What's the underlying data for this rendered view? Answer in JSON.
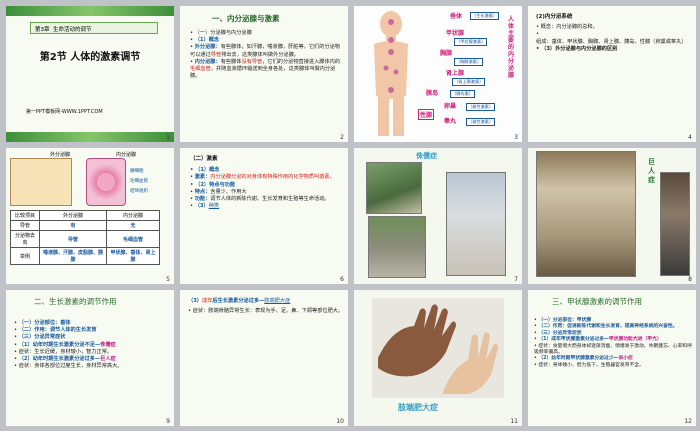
{
  "slides": [
    {
      "num": "1",
      "ch": "第3章",
      "ch_title": "生命活动的调节",
      "sec": "第2节",
      "sec_title": "人体的激素调节",
      "site": "第一PPT模板网-WWW.1PPT.COM"
    },
    {
      "num": "2",
      "title": "一、内分泌腺与激素",
      "l1": "（一）分泌腺与内分泌腺",
      "l2": "（1）概念",
      "l3a": "外分泌腺：",
      "l3b": "有些腺体，如汗腺，唾液腺，肝脏等，它们的分泌物可以通过",
      "l3c": "导管",
      "l3d": "排出去，这类腺体叫做外分泌腺。",
      "l4a": "内分泌腺：",
      "l4b": "有些腺体",
      "l4c": "没有导管",
      "l4d": "，它们的分泌物直接进入腺体内的",
      "l4e": "毛细血管",
      "l4f": "，并随血液循环输送到全身各处，这类腺体叫做内分泌腺。"
    },
    {
      "num": "3",
      "labels": [
        "垂体",
        "甲状腺",
        "胸腺",
        "肾上腺",
        "胰岛",
        "卵巢",
        "睾丸"
      ],
      "subs": [
        "（生长激素）",
        "（甲状腺激素）",
        "（胸腺激素）",
        "（肾上腺激素）",
        "（胰岛素）",
        "（雌性激素）",
        "（雄性激素）"
      ],
      "side": "人体主要的内分泌腺",
      "sex": "性腺"
    },
    {
      "num": "4",
      "title": "(2)内分泌系统",
      "l1": "概念：内分泌腺的总和。",
      "l2": "组成：垂体、甲状腺、胸腺、肾上腺、胰岛、性腺（卵巢或睾丸）",
      "l3": "（3）外分泌腺与内分泌腺的区别"
    },
    {
      "num": "5",
      "head_l": "外分泌腺",
      "head_r": "内分泌腺",
      "tags": [
        "腺细胞",
        "毛细血管",
        "结缔组织"
      ],
      "rows": [
        [
          "比较项目",
          "外分泌腺",
          "内分泌腺"
        ],
        [
          "导管",
          "有",
          "无"
        ],
        [
          "分泌物去向",
          "导管",
          "毛细血管"
        ],
        [
          "举例",
          "唾液腺、汗腺、皮脂腺、胰腺",
          "甲状腺、垂体、肾上腺"
        ]
      ]
    },
    {
      "num": "6",
      "title": "（二）激素",
      "l1": "（1）概念",
      "l2a": "激素：",
      "l2b": "内分泌腺分泌的对身体有特殊作用的化学物质叫激素。",
      "l3": "（2）特点与功能",
      "l4a": "特点：",
      "l4b": "含量少、作用大",
      "l5a": "功能：",
      "l5b": "调节人体的新陈代谢、生长发育和生殖等生命活动。",
      "l6a": "（3）",
      "l6b": "种类"
    },
    {
      "num": "7",
      "title": "侏儒症"
    },
    {
      "num": "8",
      "title": "巨人症"
    },
    {
      "num": "9",
      "title": "二、生长激素的调节作用",
      "l1": "（一）分泌部位：垂体",
      "l2": "（二）作用：调节人体的生长发育",
      "l3": "（三）分泌异常症状",
      "l4a": "（1）幼年时期生长激素分泌不足—",
      "l4b": "侏儒症",
      "l5": "症状：生长迟缓，身材矮小，智力正常。",
      "l6a": "（2）幼年时期生长激素分泌过多—",
      "l6b": "巨人症",
      "l7": "症状：身体各部位过度生长，身材异常高大。"
    },
    {
      "num": "10",
      "l1a": "（3）",
      "l1b": "成年",
      "l1c": "后生长激素分泌过多—",
      "l1d": "肢端肥大症",
      "l2": "症状：肢端骨骼异常生长：表现为手、足、鼻、下颌等部位肥大。"
    },
    {
      "num": "11",
      "caption": "肢端肥大症"
    },
    {
      "num": "12",
      "title": "三、甲状腺激素的调节作用",
      "l1": "（一）分泌部位：甲状腺",
      "l2": "（二）作用：促进新陈代谢和生长发育，提高神经系统的兴奋性。",
      "l3": "（三）分泌异常症状",
      "l4a": "（1）成年甲状腺激素分泌过多—",
      "l4b": "甲状腺功能亢进（甲亢）",
      "l5": "症状：食量增大而身体却逐渐消瘦、情绪易于激动、失眠健忘、心率和呼吸频率偏高。",
      "l6a": "（2）幼年时期甲状腺激素分泌过少—",
      "l6b": "呆小症",
      "l7": "症状：身体矮小、智力低下，生殖器官发育不全。"
    }
  ]
}
